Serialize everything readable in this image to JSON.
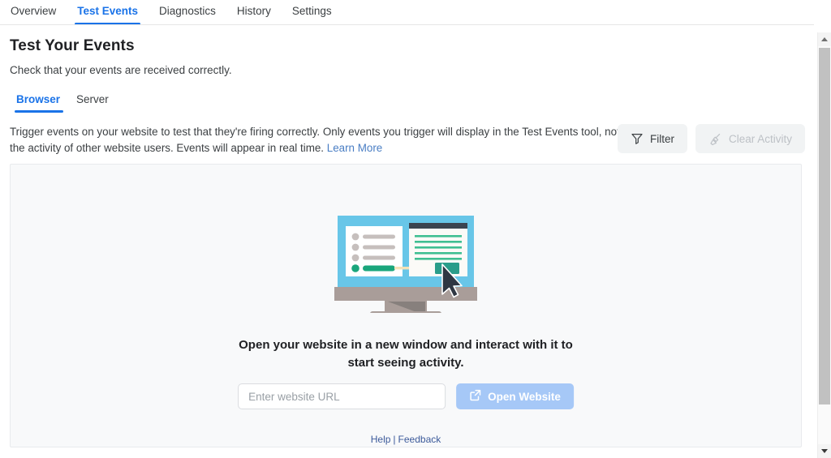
{
  "nav": {
    "tabs": [
      {
        "label": "Overview",
        "active": false
      },
      {
        "label": "Test Events",
        "active": true
      },
      {
        "label": "Diagnostics",
        "active": false
      },
      {
        "label": "History",
        "active": false
      },
      {
        "label": "Settings",
        "active": false
      }
    ]
  },
  "header": {
    "title": "Test Your Events",
    "subtitle": "Check that your events are received correctly."
  },
  "subtabs": [
    {
      "label": "Browser",
      "active": true
    },
    {
      "label": "Server",
      "active": false
    }
  ],
  "description": {
    "text": "Trigger events on your website to test that they're firing correctly. Only events you trigger will display in the Test Events tool, not the activity of other website users. Events will appear in real time.",
    "link_label": "Learn More"
  },
  "actions": {
    "filter_label": "Filter",
    "filter_icon": "funnel-icon",
    "clear_label": "Clear Activity",
    "clear_icon": "broom-icon",
    "clear_disabled": true
  },
  "empty_state": {
    "illustration": "monitor-with-cursor-illustration",
    "headline": "Open your website in a new window and interact with it to start seeing activity.",
    "url_placeholder": "Enter website URL",
    "url_value": "",
    "open_button_label": "Open Website",
    "open_button_icon": "external-link-icon"
  },
  "footer": {
    "help_label": "Help",
    "separator": "|",
    "feedback_label": "Feedback"
  },
  "scrollbar": {
    "up_icon": "caret-up-icon",
    "down_icon": "caret-down-icon"
  },
  "colors": {
    "accent_blue": "#1a73e8",
    "link_blue": "#4a7ec4",
    "button_blue": "#a6c8f7",
    "panel_bg": "#f8f9fa",
    "illus_screen": "#68c6e8",
    "illus_green": "#1aa67c",
    "illus_base": "#a99d99",
    "text_primary": "#202124",
    "text_secondary": "#3c4043",
    "text_disabled": "#bdc1c6"
  }
}
